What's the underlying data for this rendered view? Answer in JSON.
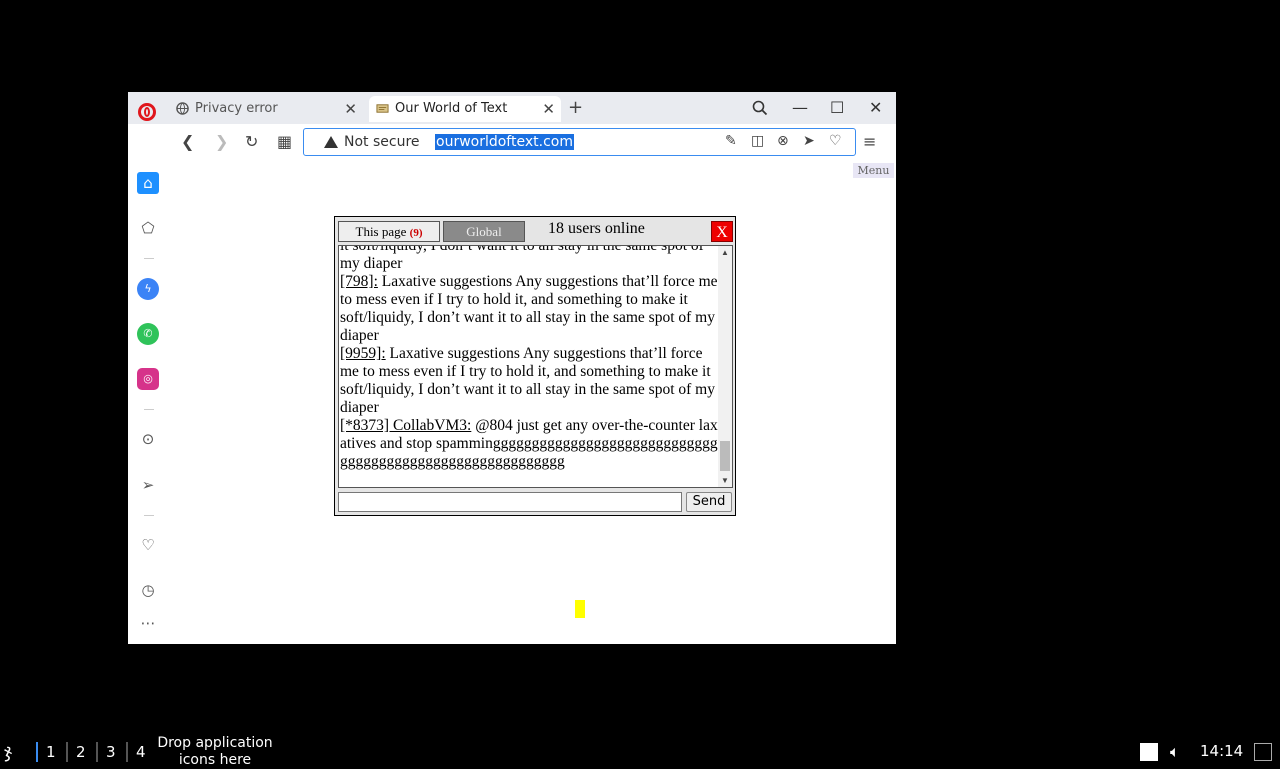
{
  "browser": {
    "tabs": [
      {
        "title": "Privacy error",
        "active": false
      },
      {
        "title": "Our World of Text",
        "active": true
      }
    ],
    "address_bar": {
      "security": "Not secure",
      "url": "ourworldoftext.com"
    }
  },
  "page": {
    "menu_label": "Menu",
    "chat": {
      "tab_page_label": "This page",
      "tab_page_count": "(9)",
      "tab_global_label": "Global",
      "users_online": "18 users online",
      "close_label": "X",
      "messages": [
        {
          "user": "",
          "text": "it soft/liquidy, I don’t want it to all stay in the same spot of my diaper"
        },
        {
          "user": "[798]:",
          "text": " Laxative suggestions Any suggestions that’ll force me to mess even if I try to hold it, and something to make it soft/liquidy, I don’t want it to all stay in the same spot of my diaper"
        },
        {
          "user": "[9959]:",
          "text": " Laxative suggestions Any suggestions that’ll force me to mess even if I try to hold it, and something to make it soft/liquidy, I don’t want it to all stay in the same spot of my diaper"
        },
        {
          "user": "[*8373] CollabVM3:",
          "text": " @804 just get any over-the-counter laxatives and stop spammingggggggggggggggggggggggggggggggggggggggggggggggggggggggggg"
        }
      ],
      "input_value": "",
      "send_label": "Send"
    }
  },
  "taskbar": {
    "workspaces": [
      "1",
      "2",
      "3",
      "4"
    ],
    "drop_hint": "Drop application icons here",
    "clock": "14:14"
  },
  "colors": {
    "accent": "#1a6fe0",
    "close_red": "#e00000",
    "count_red": "#cc0000"
  }
}
